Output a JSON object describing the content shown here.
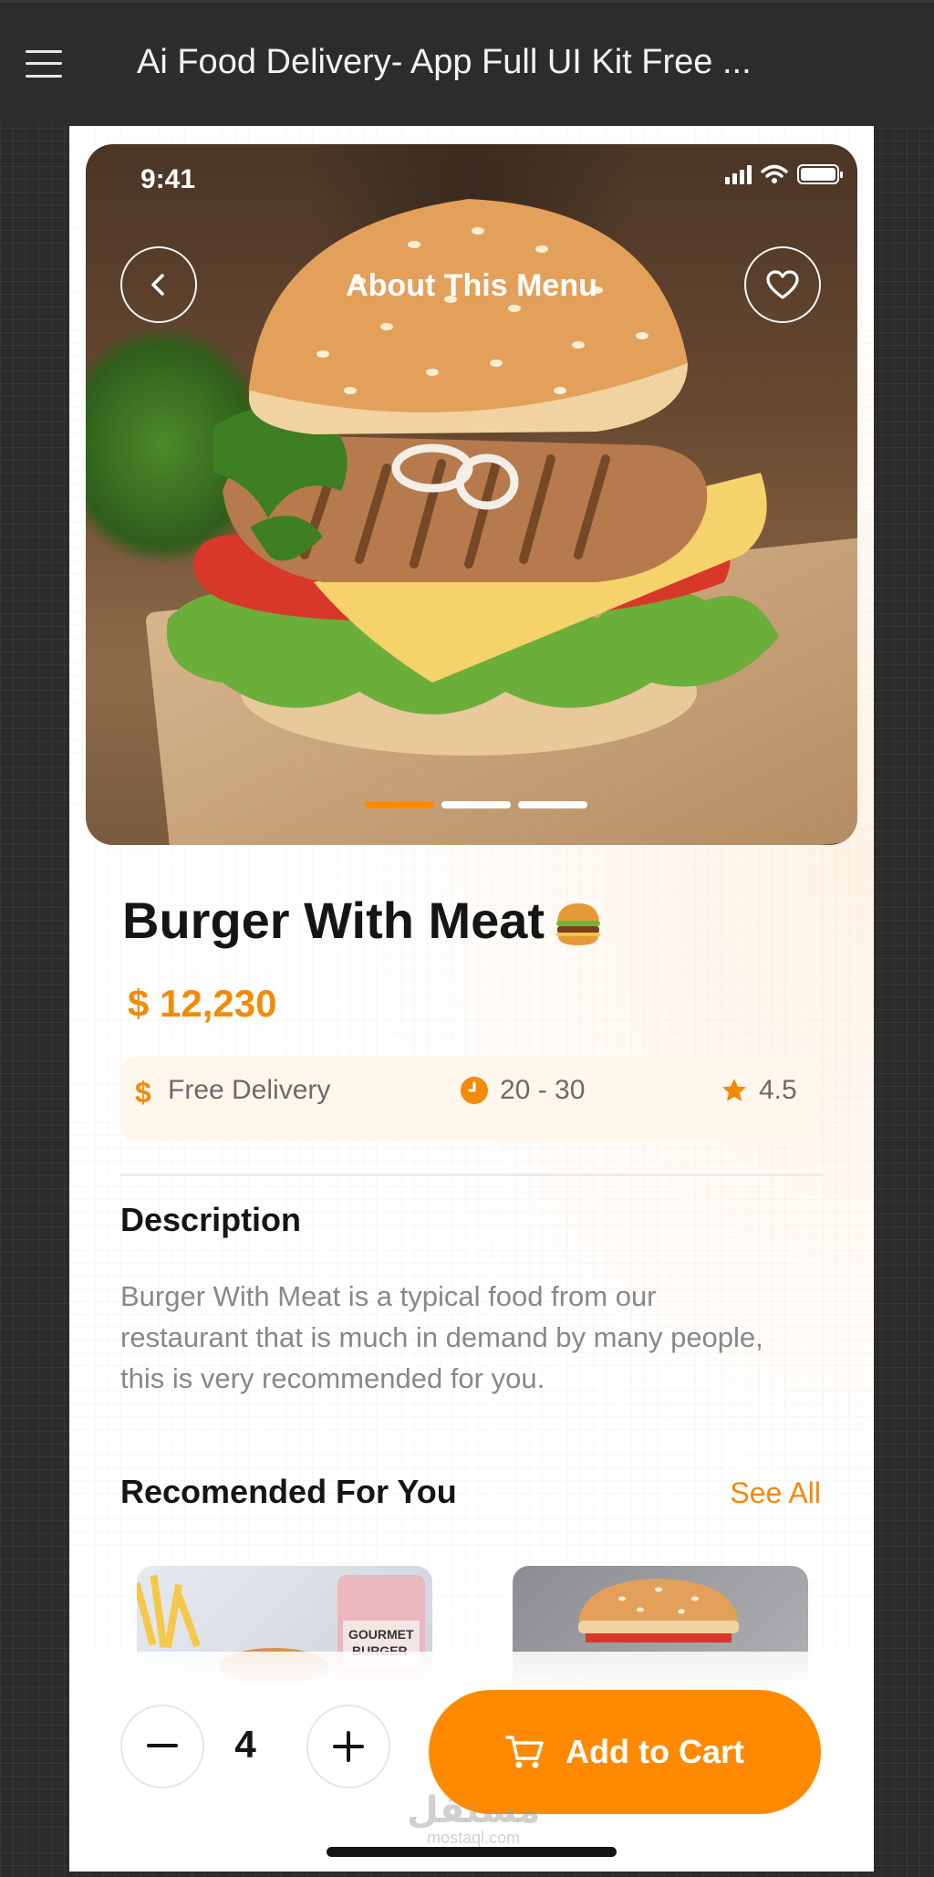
{
  "viewer": {
    "title": "Ai Food Delivery- App Full UI Kit Free ..."
  },
  "status_bar": {
    "time": "9:41"
  },
  "hero": {
    "title": "About This Menu",
    "slides": 3,
    "active_slide": 1
  },
  "product": {
    "name": "Burger With Meat",
    "price": "$ 12,230",
    "delivery": "Free Delivery",
    "time": "20 - 30",
    "rating": "4.5"
  },
  "description": {
    "title": "Description",
    "text": "Burger With Meat is a typical food from our restaurant that is much in demand by many people, this is very recommended for you."
  },
  "recommended": {
    "title": "Recomended For You",
    "see_all": "See All"
  },
  "cart": {
    "quantity": "4",
    "add_label": "Add to Cart"
  },
  "watermark": {
    "arabic": "مستقل",
    "site": "mostaql.com"
  },
  "colors": {
    "accent": "#ff8a00",
    "price": "#f28a0a",
    "info_bg": "#fff6ec"
  },
  "icons": [
    "menu-icon",
    "back-arrow-icon",
    "heart-icon",
    "dollar-icon",
    "clock-icon",
    "star-icon",
    "minus-icon",
    "plus-icon",
    "cart-icon",
    "signal-icon",
    "wifi-icon",
    "battery-icon",
    "burger-emoji"
  ]
}
